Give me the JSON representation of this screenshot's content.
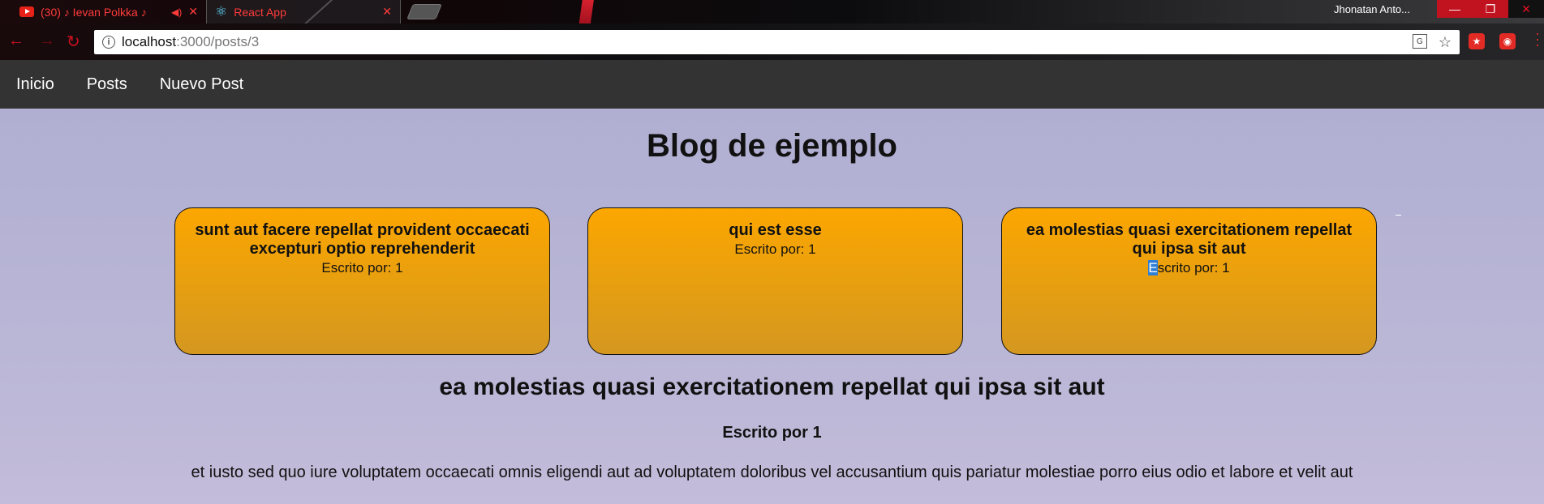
{
  "browser": {
    "tabs": [
      {
        "label": "(30) ♪ Ievan Polkka ♪"
      },
      {
        "label": "React App"
      }
    ],
    "user": "Jhonatan Anto...",
    "url": {
      "host": "localhost",
      "path": ":3000/posts/3"
    }
  },
  "nav": {
    "items": [
      {
        "label": "Inicio"
      },
      {
        "label": "Posts"
      },
      {
        "label": "Nuevo Post"
      }
    ]
  },
  "page": {
    "title": "Blog de ejemplo"
  },
  "cards": [
    {
      "title": "sunt aut facere repellat provident occaecati excepturi optio reprehenderit",
      "author": "Escrito por: 1"
    },
    {
      "title": "qui est esse",
      "author": "Escrito por: 1"
    },
    {
      "title": "ea molestias quasi exercitationem repellat qui ipsa sit aut",
      "author_first": "E",
      "author_rest": "scrito por: 1"
    }
  ],
  "post": {
    "title": "ea molestias quasi exercitationem repellat qui ipsa sit aut",
    "author": "Escrito por 1",
    "body": "et iusto sed quo iure voluptatem occaecati omnis eligendi aut ad voluptatem doloribus vel accusantium quis pariatur molestiae porro eius odio et labore et velit aut"
  },
  "colors": {
    "card": "#fca600",
    "nav": "#333333",
    "background": "#b6b3d3",
    "accent": "#e32b26"
  }
}
